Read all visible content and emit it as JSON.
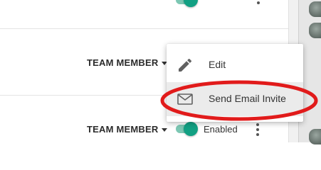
{
  "rows": [
    {
      "role": "TEAM MEMBER"
    },
    {
      "role": "TEAM MEMBER",
      "status": "Enabled"
    }
  ],
  "menu": {
    "items": [
      {
        "label": "Edit",
        "icon": "pencil-icon"
      },
      {
        "label": "Send Email Invite",
        "icon": "envelope-icon",
        "highlighted": true
      }
    ]
  },
  "colors": {
    "toggle_on": "#12a083",
    "annotation": "#e11b1b"
  }
}
